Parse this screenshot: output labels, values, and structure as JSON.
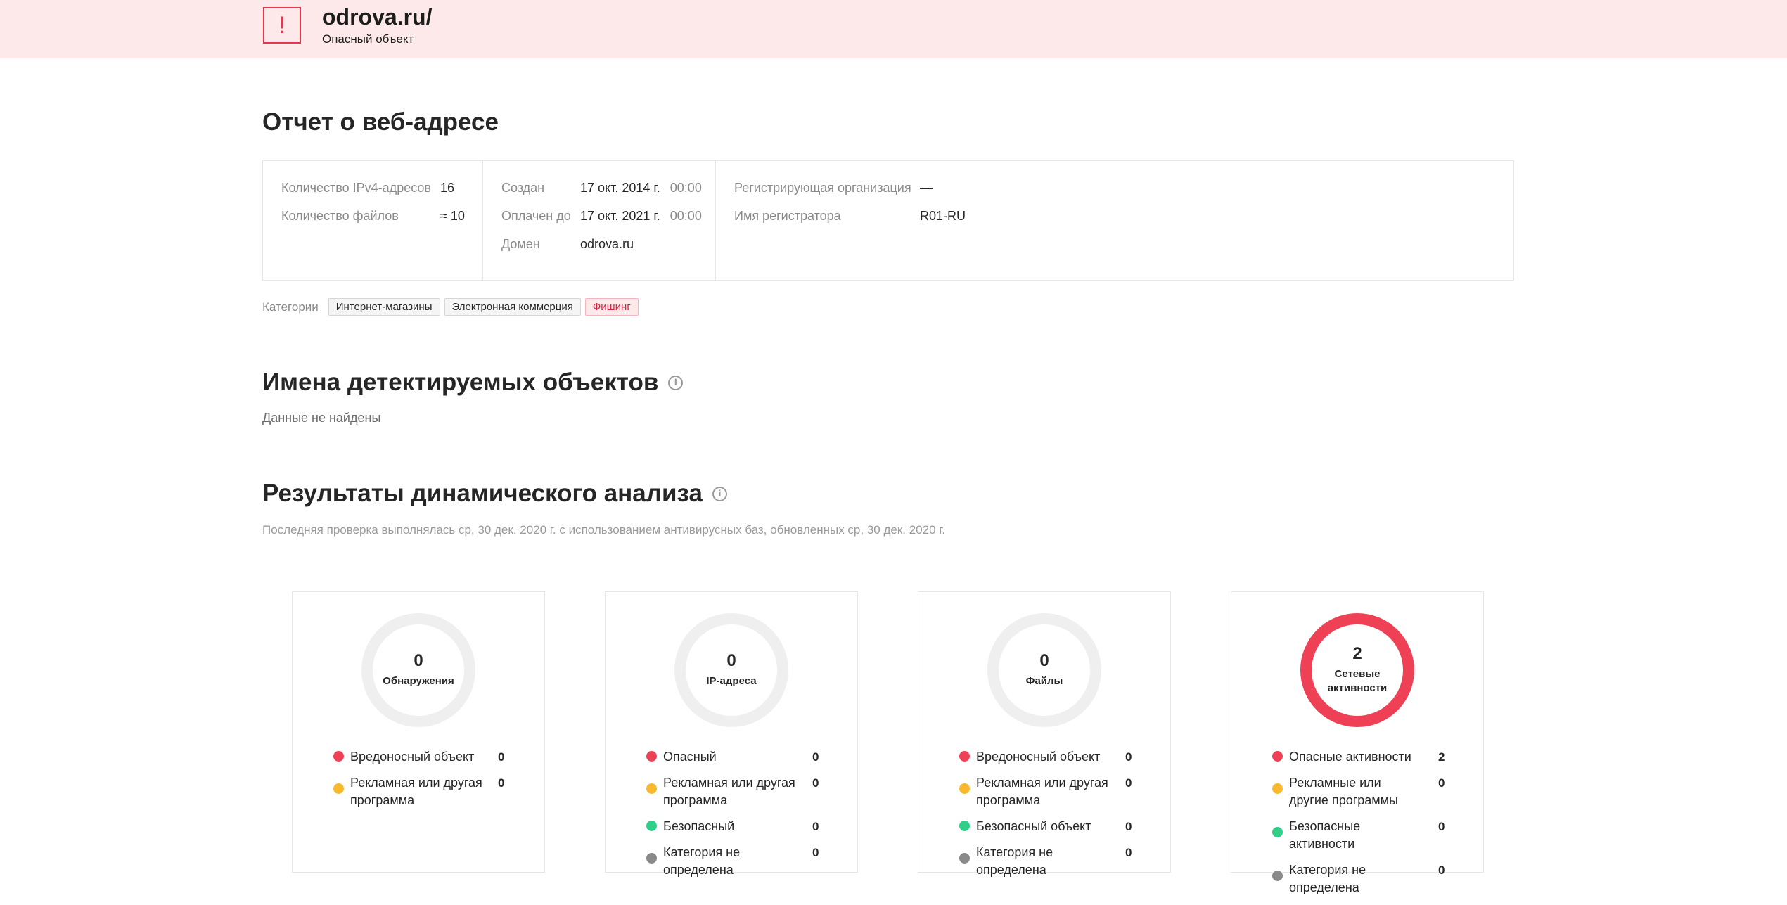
{
  "header": {
    "warning_glyph": "!",
    "site": "odrova.ru/",
    "status": "Опасный объект",
    "color_danger": "#e8344c",
    "color_banner": "#fde8ea"
  },
  "report": {
    "title": "Отчет о веб-адресе",
    "col1": [
      {
        "label": "Количество IPv4-адресов",
        "value": "16"
      },
      {
        "label": "Количество файлов",
        "value": "≈ 10"
      }
    ],
    "col2": [
      {
        "label": "Создан",
        "value": "17 окт. 2014 г.",
        "time": "00:00"
      },
      {
        "label": "Оплачен до",
        "value": "17 окт. 2021 г.",
        "time": "00:00"
      },
      {
        "label": "Домен",
        "value": "odrova.ru"
      }
    ],
    "col3": [
      {
        "label": "Регистрирующая организация",
        "value": "—"
      },
      {
        "label": "Имя регистратора",
        "value": "R01-RU"
      }
    ],
    "categories_label": "Категории",
    "categories": [
      "Интернет-магазины",
      "Электронная коммерция",
      "Фишинг"
    ]
  },
  "detected": {
    "title": "Имена детектируемых объектов",
    "info_icon": "ⓘ",
    "empty": "Данные не найдены"
  },
  "dynamic": {
    "title": "Результаты динамического анализа",
    "info_icon": "ⓘ",
    "last_check": "Последняя проверка выполнялась ср, 30 дек. 2020 г. с использованием антивирусных баз, обновленных ср, 30 дек. 2020 г.",
    "cards": [
      {
        "count": "0",
        "label": "Обнаружения",
        "items": [
          {
            "text": "Вредоносный объект",
            "count": "0",
            "color": "red"
          },
          {
            "text": "Рекламная или другая программа",
            "count": "0",
            "color": "yellow"
          }
        ]
      },
      {
        "count": "0",
        "label": "IP-адреса",
        "items": [
          {
            "text": "Опасный",
            "count": "0",
            "color": "red"
          },
          {
            "text": "Рекламная или другая программа",
            "count": "0",
            "color": "yellow"
          },
          {
            "text": "Безопасный",
            "count": "0",
            "color": "green"
          },
          {
            "text": "Категория не определена",
            "count": "0",
            "color": "gray"
          }
        ]
      },
      {
        "count": "0",
        "label": "Файлы",
        "items": [
          {
            "text": "Вредоносный объект",
            "count": "0",
            "color": "red"
          },
          {
            "text": "Рекламная или другая программа",
            "count": "0",
            "color": "yellow"
          },
          {
            "text": "Безопасный объект",
            "count": "0",
            "color": "green"
          },
          {
            "text": "Категория не определена",
            "count": "0",
            "color": "gray"
          }
        ]
      },
      {
        "count": "2",
        "label": "Сетевые активности",
        "items": [
          {
            "text": "Опасные активности",
            "count": "2",
            "color": "red"
          },
          {
            "text": "Рекламные или другие программы",
            "count": "0",
            "color": "yellow"
          },
          {
            "text": "Безопасные активности",
            "count": "0",
            "color": "green"
          },
          {
            "text": "Категория не определена",
            "count": "0",
            "color": "gray"
          }
        ]
      }
    ]
  }
}
